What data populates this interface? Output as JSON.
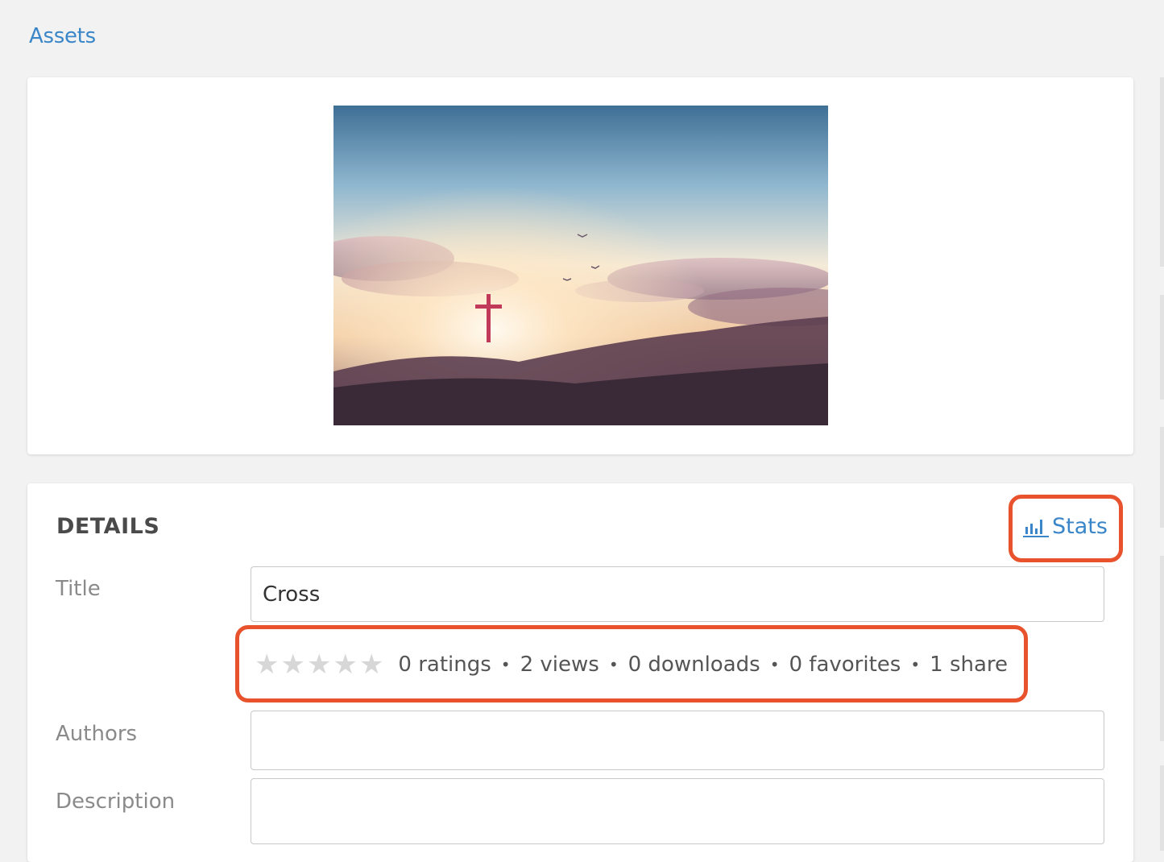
{
  "breadcrumb": {
    "label": "Assets"
  },
  "image": {
    "alt": "",
    "colors": {
      "sky_top": "#3e6f95",
      "glow": "#fff6e6",
      "cross": "#c23a5a",
      "mountain": "#3a2a38"
    }
  },
  "details": {
    "heading": "DETAILS",
    "stats_link": {
      "label": "Stats",
      "icon": "bar-chart-icon"
    },
    "fields": {
      "title": {
        "label": "Title",
        "value": "Cross",
        "placeholder": ""
      },
      "authors": {
        "label": "Authors",
        "value": "",
        "placeholder": ""
      },
      "description": {
        "label": "Description",
        "value": "",
        "placeholder": ""
      }
    },
    "rating": {
      "stars_total": 5,
      "stars_filled": 0
    },
    "stats": {
      "ratings": "0 ratings",
      "views": "2 views",
      "downloads": "0 downloads",
      "favorites": "0 favorites",
      "shares": "1 share"
    }
  },
  "colors": {
    "accent": "#3a86c8",
    "highlight": "#e8532e",
    "background": "#f2f2f2"
  }
}
